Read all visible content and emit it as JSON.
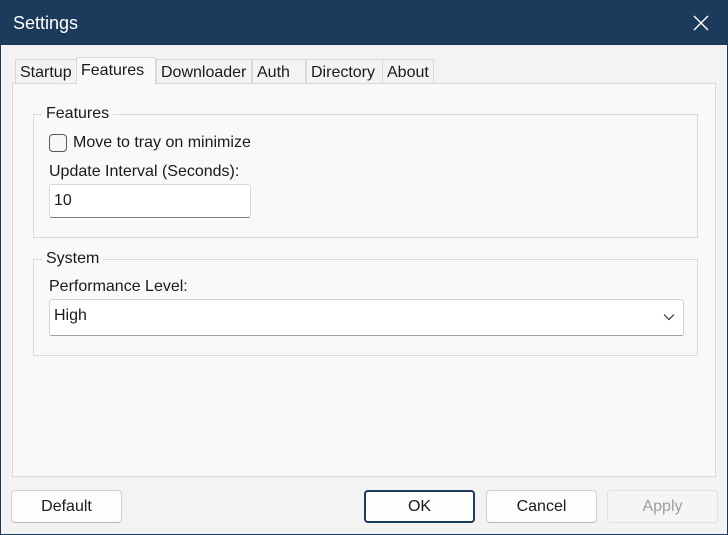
{
  "window": {
    "title": "Settings"
  },
  "tabs": [
    {
      "label": "Startup"
    },
    {
      "label": "Features"
    },
    {
      "label": "Downloader"
    },
    {
      "label": "Auth"
    },
    {
      "label": "Directory"
    },
    {
      "label": "About"
    }
  ],
  "active_tab": "Features",
  "features_group": {
    "title": "Features",
    "tray_checkbox_label": "Move to tray on minimize",
    "tray_checked": false,
    "update_interval_label": "Update Interval (Seconds):",
    "update_interval_value": "10"
  },
  "system_group": {
    "title": "System",
    "performance_label": "Performance Level:",
    "performance_value": "High"
  },
  "buttons": {
    "default": "Default",
    "ok": "OK",
    "cancel": "Cancel",
    "apply": "Apply"
  },
  "colors": {
    "titlebar": "#1b3a5c",
    "window_bg": "#f3f3f3",
    "panel_bg": "#f9f9f9"
  }
}
